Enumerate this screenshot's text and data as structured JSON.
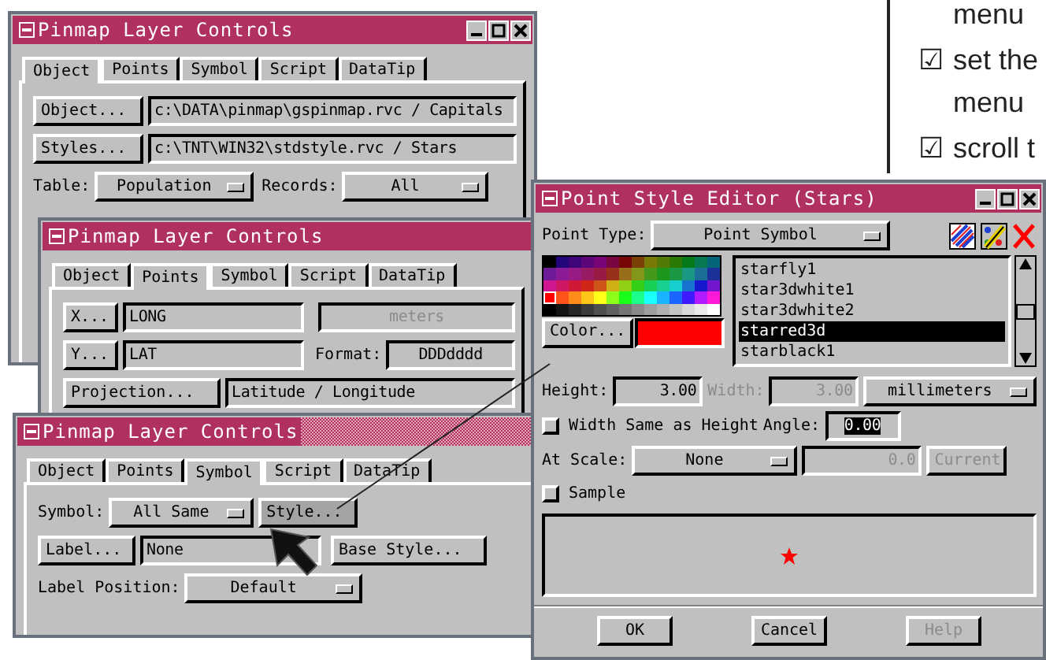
{
  "windows": [
    {
      "title": "Pinmap Layer Controls",
      "active": true,
      "tabs": [
        {
          "label": "Object",
          "selected": true
        },
        {
          "label": "Points",
          "selected": false
        },
        {
          "label": "Symbol",
          "selected": false
        },
        {
          "label": "Script",
          "selected": false
        },
        {
          "label": "DataTip",
          "selected": false
        }
      ],
      "rows": [
        {
          "items": [
            {
              "kind": "button",
              "text": "Object...",
              "disabled": false
            },
            {
              "kind": "field",
              "value": "c:\\DATA\\pinmap\\gspinmap.rvc / Capitals",
              "disabled": false
            }
          ]
        },
        {
          "items": [
            {
              "kind": "button",
              "text": "Styles...",
              "disabled": false
            },
            {
              "kind": "field",
              "value": "c:\\TNT\\WIN32\\stdstyle.rvc / Stars",
              "disabled": false
            }
          ]
        },
        {
          "items": [
            {
              "kind": "label",
              "text": "Table:"
            },
            {
              "kind": "dropdown",
              "value": "Population"
            },
            {
              "kind": "label",
              "text": "Records:"
            },
            {
              "kind": "dropdown",
              "value": "All"
            }
          ]
        }
      ]
    },
    {
      "title": "Pinmap Layer Controls",
      "active": true,
      "tabs": [
        {
          "label": "Object",
          "selected": false
        },
        {
          "label": "Points",
          "selected": true
        },
        {
          "label": "Symbol",
          "selected": false
        },
        {
          "label": "Script",
          "selected": false
        },
        {
          "label": "DataTip",
          "selected": false
        }
      ],
      "rows": [
        {
          "items": [
            {
              "kind": "button",
              "text": "X...",
              "disabled": false
            },
            {
              "kind": "field",
              "value": "LONG",
              "disabled": false
            },
            {
              "kind": "field",
              "value": "meters",
              "disabled": true
            }
          ]
        },
        {
          "items": [
            {
              "kind": "button",
              "text": "Y...",
              "disabled": false
            },
            {
              "kind": "field",
              "value": "LAT",
              "disabled": false
            },
            {
              "kind": "label",
              "text": "Format:"
            },
            {
              "kind": "field",
              "value": "DDDdddd",
              "disabled": false
            }
          ]
        },
        {
          "items": [
            {
              "kind": "button",
              "text": "Projection...",
              "disabled": false
            },
            {
              "kind": "field",
              "value": "Latitude / Longitude",
              "disabled": false
            }
          ]
        }
      ]
    },
    {
      "title": "Pinmap Layer Controls",
      "active": false,
      "tabs": [
        {
          "label": "Object",
          "selected": false
        },
        {
          "label": "Points",
          "selected": false
        },
        {
          "label": "Symbol",
          "selected": true
        },
        {
          "label": "Script",
          "selected": false
        },
        {
          "label": "DataTip",
          "selected": false
        }
      ],
      "rows": [
        {
          "items": [
            {
              "kind": "label",
              "text": "Symbol:"
            },
            {
              "kind": "dropdown",
              "value": "All Same"
            },
            {
              "kind": "button",
              "text": "Style...",
              "disabled": false,
              "selected": true
            }
          ]
        },
        {
          "items": [
            {
              "kind": "button",
              "text": "Label...",
              "disabled": false,
              "selected": false
            },
            {
              "kind": "field",
              "value": "None",
              "disabled": false
            },
            {
              "kind": "button",
              "text": "Base Style...",
              "disabled": false,
              "selected": false
            }
          ]
        },
        {
          "items": [
            {
              "kind": "label",
              "text": "Label Position:"
            },
            {
              "kind": "dropdown",
              "value": "Default"
            }
          ]
        }
      ]
    },
    {
      "title": "Point Style Editor (Stars)",
      "active": true,
      "point_type": {
        "label": "Point Type:",
        "value": "Point Symbol"
      },
      "color_button": "Color...",
      "symbols": [
        {
          "name": "starfly1",
          "selected": false
        },
        {
          "name": "star3dwhite1",
          "selected": false
        },
        {
          "name": "star3dwhite2",
          "selected": false
        },
        {
          "name": "starred3d",
          "selected": true
        },
        {
          "name": "starblack1",
          "selected": false
        }
      ],
      "height": {
        "label": "Height:",
        "value": "3.00"
      },
      "width": {
        "label": "Width:",
        "value": "3.00",
        "disabled": true
      },
      "units": "millimeters",
      "same_width": {
        "label": "Width Same as Height",
        "checked": false
      },
      "angle": {
        "label": "Angle:",
        "value": "0.00",
        "selected": true
      },
      "at_scale": {
        "label": "At Scale:",
        "value": "None",
        "scale": "0.0",
        "button": "Current",
        "disabled": true
      },
      "sample": {
        "label": "Sample",
        "checked": false
      },
      "buttons": [
        {
          "text": "OK",
          "disabled": false
        },
        {
          "text": "Cancel",
          "disabled": false
        },
        {
          "text": "Help",
          "disabled": true
        }
      ]
    }
  ],
  "notes": [
    {
      "text": "menu"
    },
    {
      "bullet": "☑",
      "text": "set the"
    },
    {
      "text": "menu"
    },
    {
      "bullet": "☑",
      "text": "scroll t"
    }
  ]
}
